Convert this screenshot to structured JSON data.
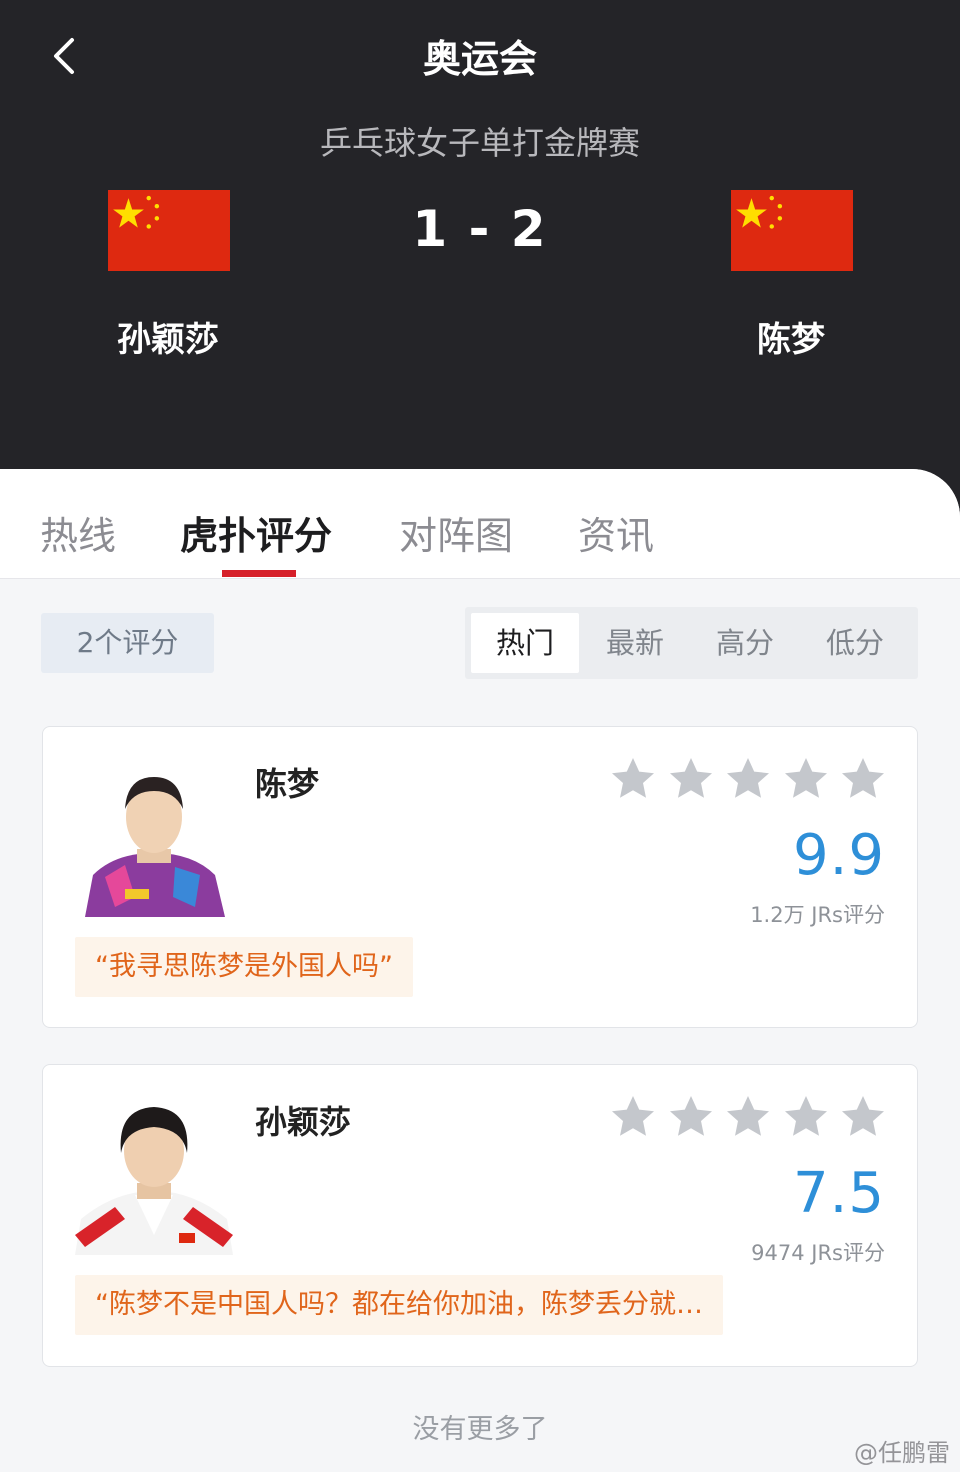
{
  "header": {
    "title": "奥运会",
    "match_title": "乒乓球女子单打金牌赛",
    "score": "1 - 2",
    "left_player": "孙颖莎",
    "right_player": "陈梦",
    "left_flag": "china-flag",
    "right_flag": "china-flag"
  },
  "tabs": [
    {
      "label": "热线",
      "active": false
    },
    {
      "label": "虎扑评分",
      "active": true
    },
    {
      "label": "对阵图",
      "active": false
    },
    {
      "label": "资讯",
      "active": false
    }
  ],
  "filter": {
    "count_label": "2个评分",
    "sort_options": [
      "热门",
      "最新",
      "高分",
      "低分"
    ],
    "active_sort": "热门"
  },
  "ratings": [
    {
      "name": "陈梦",
      "stars": 5,
      "score": "9.9",
      "votes": "1.2万 JRs评分",
      "quote": "“我寻思陈梦是外国人吗”"
    },
    {
      "name": "孙颖莎",
      "stars": 5,
      "score": "7.5",
      "votes": "9474 JRs评分",
      "quote": "“陈梦不是中国人吗？都在给你加油，陈梦丢分就…"
    }
  ],
  "footer": {
    "no_more": "没有更多了",
    "watermark": "@任鹏雷"
  },
  "colors": {
    "header_bg": "#242428",
    "accent_red": "#d6202a",
    "score_blue": "#2e8fd8",
    "quote_orange": "#e0651b",
    "quote_bg": "#fdf4ea",
    "star_gray": "#c4c7cc"
  }
}
